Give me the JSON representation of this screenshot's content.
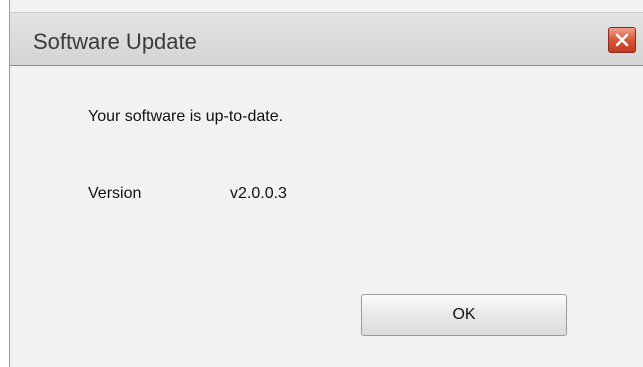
{
  "dialog": {
    "title": "Software Update",
    "close_icon": "close-icon",
    "message": "Your software is up-to-date.",
    "version_label": "Version",
    "version_value": "v2.0.0.3",
    "ok_label": "OK"
  },
  "colors": {
    "close_button": "#d9553a",
    "dialog_background": "#f2f2f2",
    "titlebar_background": "#d4d4d4"
  }
}
